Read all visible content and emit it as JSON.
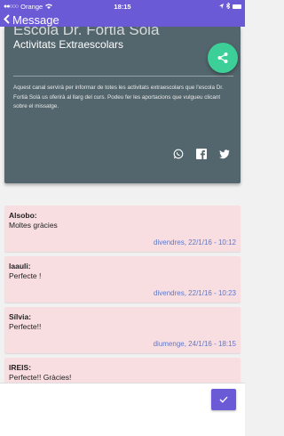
{
  "statusbar": {
    "carrier": "Orange",
    "time": "18:15"
  },
  "navbar": {
    "title": "Message"
  },
  "channel": {
    "title": "Escola Dr. Fortià Solà",
    "subtitle": "Activitats Extraescolars",
    "description": "Aquest canal servirà per informar de totes les activitats extraescolars que l'escola Dr. Fortià Solà us oferirà al llarg del curs. Podeu fer les aportacions que vulgueu clicant sobre el missatge."
  },
  "messages": [
    {
      "author": "Alsobo:",
      "text": "Moltes gràcies",
      "date": "divendres, 22/1/16 - 10:12"
    },
    {
      "author": "laauli:",
      "text": "Perfecte !",
      "date": "divendres, 22/1/16 - 10:23"
    },
    {
      "author": "Sílvia:",
      "text": "Perfecte!!",
      "date": "diumenge, 24/1/16 - 18:15"
    },
    {
      "author": "IREIS:",
      "text": "Perfecte!! Gràcies!",
      "date": ""
    }
  ],
  "composer": {
    "placeholder": ""
  },
  "colors": {
    "primary": "#6b5ad6",
    "header": "#53666d",
    "fab": "#3ccf98",
    "message_bg": "#f8dee1",
    "date": "#5f78c8"
  }
}
